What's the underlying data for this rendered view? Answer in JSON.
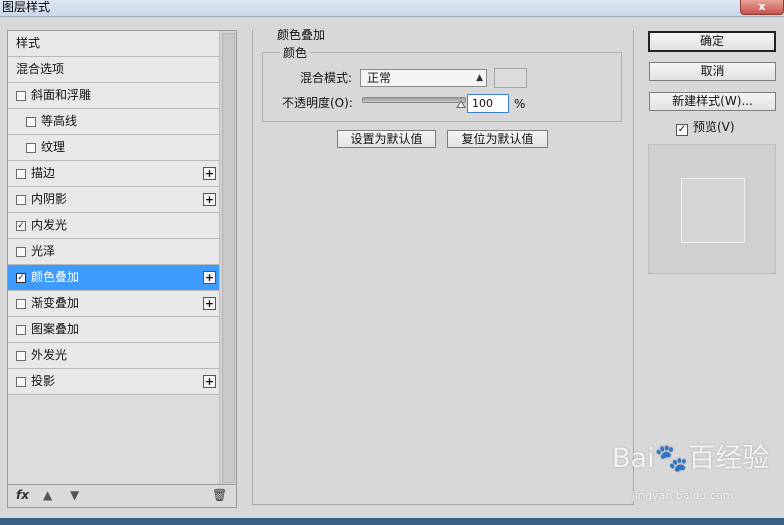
{
  "window": {
    "title": "图层样式",
    "close_label": "x"
  },
  "styles_list": {
    "items": [
      {
        "label": "样式",
        "has_checkbox": false,
        "checked": false,
        "indent": 0,
        "has_plus": false,
        "selected": false
      },
      {
        "label": "混合选项",
        "has_checkbox": false,
        "checked": false,
        "indent": 0,
        "has_plus": false,
        "selected": false
      },
      {
        "label": "斜面和浮雕",
        "has_checkbox": true,
        "checked": false,
        "indent": 0,
        "has_plus": false,
        "selected": false
      },
      {
        "label": "等高线",
        "has_checkbox": true,
        "checked": false,
        "indent": 1,
        "has_plus": false,
        "selected": false
      },
      {
        "label": "纹理",
        "has_checkbox": true,
        "checked": false,
        "indent": 1,
        "has_plus": false,
        "selected": false
      },
      {
        "label": "描边",
        "has_checkbox": true,
        "checked": false,
        "indent": 0,
        "has_plus": true,
        "selected": false
      },
      {
        "label": "内阴影",
        "has_checkbox": true,
        "checked": false,
        "indent": 0,
        "has_plus": true,
        "selected": false
      },
      {
        "label": "内发光",
        "has_checkbox": true,
        "checked": true,
        "indent": 0,
        "has_plus": false,
        "selected": false
      },
      {
        "label": "光泽",
        "has_checkbox": true,
        "checked": false,
        "indent": 0,
        "has_plus": false,
        "selected": false
      },
      {
        "label": "颜色叠加",
        "has_checkbox": true,
        "checked": true,
        "indent": 0,
        "has_plus": true,
        "selected": true
      },
      {
        "label": "渐变叠加",
        "has_checkbox": true,
        "checked": false,
        "indent": 0,
        "has_plus": true,
        "selected": false
      },
      {
        "label": "图案叠加",
        "has_checkbox": true,
        "checked": false,
        "indent": 0,
        "has_plus": false,
        "selected": false
      },
      {
        "label": "外发光",
        "has_checkbox": true,
        "checked": false,
        "indent": 0,
        "has_plus": false,
        "selected": false
      },
      {
        "label": "投影",
        "has_checkbox": true,
        "checked": false,
        "indent": 0,
        "has_plus": true,
        "selected": false
      }
    ],
    "footer": {
      "fx_label": "fx",
      "up_icon": "arrow-up-icon",
      "down_icon": "arrow-down-icon",
      "delete_icon": "trash-icon"
    }
  },
  "color_overlay": {
    "section_title": "颜色叠加",
    "group_title": "颜色",
    "blend_mode_label": "混合模式:",
    "blend_mode_value": "正常",
    "opacity_label": "不透明度(O):",
    "opacity_value": "100",
    "opacity_unit": "%",
    "opacity_fraction": 1.0,
    "swatch_color": "#dcdcdc",
    "set_default_label": "设置为默认值",
    "reset_default_label": "复位为默认值"
  },
  "buttons": {
    "ok": "确定",
    "cancel": "取消",
    "new_style": "新建样式(W)..."
  },
  "preview": {
    "label": "预览(V)",
    "checked": true
  },
  "colors": {
    "selected_bg": "#3d9bff",
    "window_bg": "#d8d8d8"
  },
  "watermark": {
    "main": "Bai🐾百经验",
    "sub": "jingyan.baidu.com"
  }
}
